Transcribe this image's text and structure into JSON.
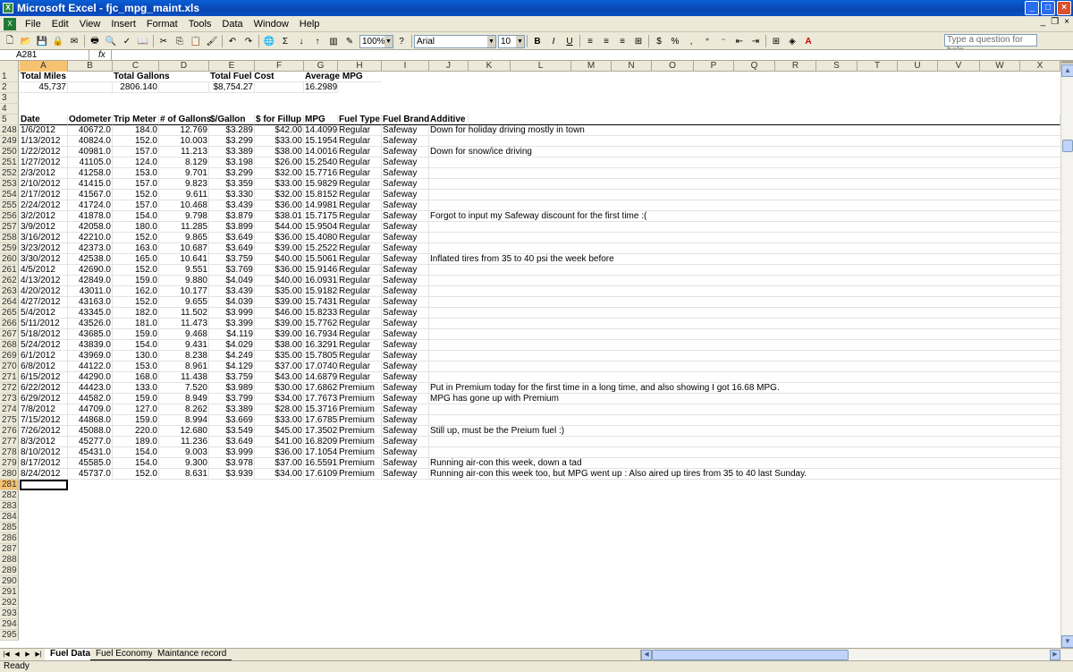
{
  "window": {
    "title": "Microsoft Excel - fjc_mpg_maint.xls"
  },
  "menu": [
    "File",
    "Edit",
    "View",
    "Insert",
    "Format",
    "Tools",
    "Data",
    "Window",
    "Help"
  ],
  "help_placeholder": "Type a question for help",
  "toolbar": {
    "zoom": "100%",
    "font": "Arial",
    "size": "10",
    "sigma": "Σ"
  },
  "namebox": "A281",
  "fx": "fx",
  "columns": [
    "A",
    "B",
    "C",
    "D",
    "E",
    "F",
    "G",
    "H",
    "I",
    "J",
    "K",
    "L",
    "M",
    "N",
    "O",
    "P",
    "Q",
    "R",
    "S",
    "T",
    "U",
    "V",
    "W",
    "X"
  ],
  "summary_row1": {
    "a": "Total Miles",
    "c": "Total Gallons",
    "e": "Total Fuel Cost",
    "g": "Average MPG"
  },
  "summary_row2": {
    "a": "45,737",
    "c": "2806.140",
    "e": "$8,754.27",
    "g": "16.2989"
  },
  "headers": [
    "Date",
    "Odometer",
    "Trip Meter",
    "# of Gallons",
    "$/Gallon",
    "$ for Fillup",
    "MPG",
    "Fuel Type",
    "Fuel Brand",
    "Additive"
  ],
  "data_rows": [
    [
      "248",
      "1/6/2012",
      "40672.0",
      "184.0",
      "12.769",
      "$3.289",
      "$42.00",
      "14.4099",
      "Regular",
      "Safeway",
      "Down for holiday driving mostly in town"
    ],
    [
      "249",
      "1/13/2012",
      "40824.0",
      "152.0",
      "10.003",
      "$3.299",
      "$33.00",
      "15.1954",
      "Regular",
      "Safeway",
      ""
    ],
    [
      "250",
      "1/22/2012",
      "40981.0",
      "157.0",
      "11.213",
      "$3.389",
      "$38.00",
      "14.0016",
      "Regular",
      "Safeway",
      "Down for snow/ice driving"
    ],
    [
      "251",
      "1/27/2012",
      "41105.0",
      "124.0",
      "8.129",
      "$3.198",
      "$26.00",
      "15.2540",
      "Regular",
      "Safeway",
      ""
    ],
    [
      "252",
      "2/3/2012",
      "41258.0",
      "153.0",
      "9.701",
      "$3.299",
      "$32.00",
      "15.7716",
      "Regular",
      "Safeway",
      ""
    ],
    [
      "253",
      "2/10/2012",
      "41415.0",
      "157.0",
      "9.823",
      "$3.359",
      "$33.00",
      "15.9829",
      "Regular",
      "Safeway",
      ""
    ],
    [
      "254",
      "2/17/2012",
      "41567.0",
      "152.0",
      "9.611",
      "$3.330",
      "$32.00",
      "15.8152",
      "Regular",
      "Safeway",
      ""
    ],
    [
      "255",
      "2/24/2012",
      "41724.0",
      "157.0",
      "10.468",
      "$3.439",
      "$36.00",
      "14.9981",
      "Regular",
      "Safeway",
      ""
    ],
    [
      "256",
      "3/2/2012",
      "41878.0",
      "154.0",
      "9.798",
      "$3.879",
      "$38.01",
      "15.7175",
      "Regular",
      "Safeway",
      "Forgot to input my Safeway discount for the first time :("
    ],
    [
      "257",
      "3/9/2012",
      "42058.0",
      "180.0",
      "11.285",
      "$3.899",
      "$44.00",
      "15.9504",
      "Regular",
      "Safeway",
      ""
    ],
    [
      "258",
      "3/16/2012",
      "42210.0",
      "152.0",
      "9.865",
      "$3.649",
      "$36.00",
      "15.4080",
      "Regular",
      "Safeway",
      ""
    ],
    [
      "259",
      "3/23/2012",
      "42373.0",
      "163.0",
      "10.687",
      "$3.649",
      "$39.00",
      "15.2522",
      "Regular",
      "Safeway",
      ""
    ],
    [
      "260",
      "3/30/2012",
      "42538.0",
      "165.0",
      "10.641",
      "$3.759",
      "$40.00",
      "15.5061",
      "Regular",
      "Safeway",
      "Inflated tires from 35 to 40 psi the week before"
    ],
    [
      "261",
      "4/5/2012",
      "42690.0",
      "152.0",
      "9.551",
      "$3.769",
      "$36.00",
      "15.9146",
      "Regular",
      "Safeway",
      ""
    ],
    [
      "262",
      "4/13/2012",
      "42849.0",
      "159.0",
      "9.880",
      "$4.049",
      "$40.00",
      "16.0931",
      "Regular",
      "Safeway",
      ""
    ],
    [
      "263",
      "4/20/2012",
      "43011.0",
      "162.0",
      "10.177",
      "$3.439",
      "$35.00",
      "15.9182",
      "Regular",
      "Safeway",
      ""
    ],
    [
      "264",
      "4/27/2012",
      "43163.0",
      "152.0",
      "9.655",
      "$4.039",
      "$39.00",
      "15.7431",
      "Regular",
      "Safeway",
      ""
    ],
    [
      "265",
      "5/4/2012",
      "43345.0",
      "182.0",
      "11.502",
      "$3.999",
      "$46.00",
      "15.8233",
      "Regular",
      "Safeway",
      ""
    ],
    [
      "266",
      "5/11/2012",
      "43526.0",
      "181.0",
      "11.473",
      "$3.399",
      "$39.00",
      "15.7762",
      "Regular",
      "Safeway",
      ""
    ],
    [
      "267",
      "5/18/2012",
      "43685.0",
      "159.0",
      "9.468",
      "$4.119",
      "$39.00",
      "16.7934",
      "Regular",
      "Safeway",
      ""
    ],
    [
      "268",
      "5/24/2012",
      "43839.0",
      "154.0",
      "9.431",
      "$4.029",
      "$38.00",
      "16.3291",
      "Regular",
      "Safeway",
      ""
    ],
    [
      "269",
      "6/1/2012",
      "43969.0",
      "130.0",
      "8.238",
      "$4.249",
      "$35.00",
      "15.7805",
      "Regular",
      "Safeway",
      ""
    ],
    [
      "270",
      "6/8/2012",
      "44122.0",
      "153.0",
      "8.961",
      "$4.129",
      "$37.00",
      "17.0740",
      "Regular",
      "Safeway",
      ""
    ],
    [
      "271",
      "6/15/2012",
      "44290.0",
      "168.0",
      "11.438",
      "$3.759",
      "$43.00",
      "14.6879",
      "Regular",
      "Safeway",
      ""
    ],
    [
      "272",
      "6/22/2012",
      "44423.0",
      "133.0",
      "7.520",
      "$3.989",
      "$30.00",
      "17.6862",
      "Premium",
      "Safeway",
      "Put in Premium today for the first time in a long time, and also showing I got 16.68 MPG."
    ],
    [
      "273",
      "6/29/2012",
      "44582.0",
      "159.0",
      "8.949",
      "$3.799",
      "$34.00",
      "17.7673",
      "Premium",
      "Safeway",
      "MPG has gone up with Premium"
    ],
    [
      "274",
      "7/8/2012",
      "44709.0",
      "127.0",
      "8.262",
      "$3.389",
      "$28.00",
      "15.3716",
      "Premium",
      "Safeway",
      ""
    ],
    [
      "275",
      "7/15/2012",
      "44868.0",
      "159.0",
      "8.994",
      "$3.669",
      "$33.00",
      "17.6785",
      "Premium",
      "Safeway",
      ""
    ],
    [
      "276",
      "7/26/2012",
      "45088.0",
      "220.0",
      "12.680",
      "$3.549",
      "$45.00",
      "17.3502",
      "Premium",
      "Safeway",
      "Still up, must be the Preium fuel :)"
    ],
    [
      "277",
      "8/3/2012",
      "45277.0",
      "189.0",
      "11.236",
      "$3.649",
      "$41.00",
      "16.8209",
      "Premium",
      "Safeway",
      ""
    ],
    [
      "278",
      "8/10/2012",
      "45431.0",
      "154.0",
      "9.003",
      "$3.999",
      "$36.00",
      "17.1054",
      "Premium",
      "Safeway",
      ""
    ],
    [
      "279",
      "8/17/2012",
      "45585.0",
      "154.0",
      "9.300",
      "$3.978",
      "$37.00",
      "16.5591",
      "Premium",
      "Safeway",
      "Running air-con this week, down a tad"
    ],
    [
      "280",
      "8/24/2012",
      "45737.0",
      "152.0",
      "8.631",
      "$3.939",
      "$34.00",
      "17.6109",
      "Premium",
      "Safeway",
      "Running air-con this week too, but MPG went up :  Also aired up tires from 35 to 40 last Sunday."
    ]
  ],
  "top_row_labels": [
    "1",
    "2",
    "3",
    "4",
    "5"
  ],
  "empty_row_labels": [
    "281",
    "282",
    "283",
    "284",
    "285",
    "286",
    "287",
    "288",
    "289",
    "290",
    "291",
    "292",
    "293",
    "294",
    "295"
  ],
  "sheet_tabs": [
    "Fuel Data",
    "Fuel Economy",
    "Maintance record"
  ],
  "status": "Ready",
  "colors": {
    "titlebar": "#0a4fc4",
    "selected_header": "#f7c26f"
  }
}
